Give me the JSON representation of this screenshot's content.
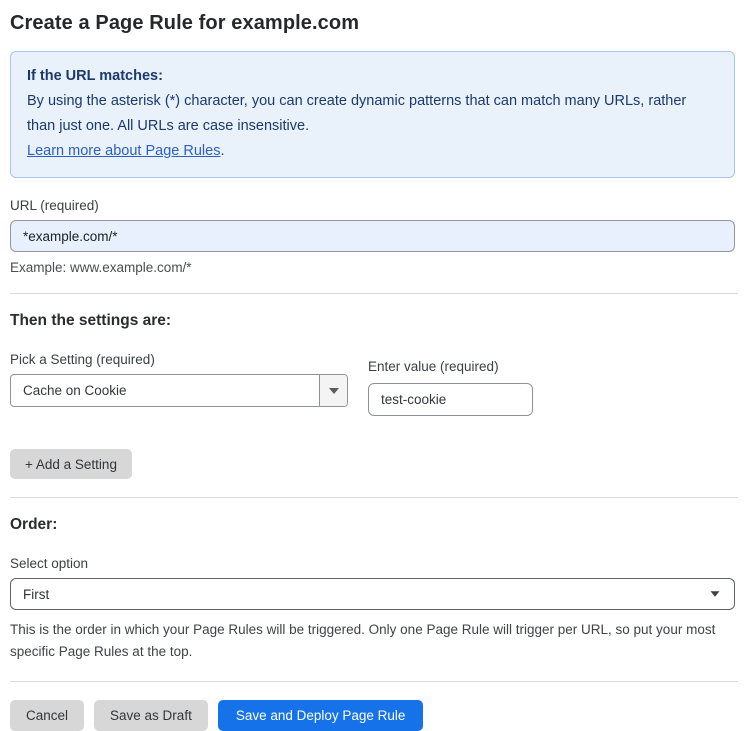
{
  "page": {
    "title": "Create a Page Rule for example.com"
  },
  "info_box": {
    "heading": "If the URL matches:",
    "body": "By using the asterisk (*) character, you can create dynamic patterns that can match many URLs, rather than just one. All URLs are case insensitive.",
    "link_label": "Learn more about Page Rules",
    "link_suffix": "."
  },
  "url_field": {
    "label": "URL (required)",
    "value": "*example.com/*",
    "example": "Example: www.example.com/*"
  },
  "settings": {
    "heading": "Then the settings are:",
    "setting_picker": {
      "label": "Pick a Setting (required)",
      "selected": "Cache on Cookie"
    },
    "value_field": {
      "label": "Enter value (required)",
      "value": "test-cookie"
    },
    "add_button_label": "+ Add a Setting"
  },
  "order": {
    "heading": "Order:",
    "select_label": "Select option",
    "selected": "First",
    "help": "This is the order in which your Page Rules will be triggered. Only one Page Rule will trigger per URL, so put your most specific Page Rules at the top."
  },
  "actions": {
    "cancel_label": "Cancel",
    "save_draft_label": "Save as Draft",
    "save_deploy_label": "Save and Deploy Page Rule"
  },
  "colors": {
    "accent_blue": "#1672e8",
    "info_bg": "#e9f1fb",
    "info_border": "#a9c7ec",
    "info_text": "#1b3a6b",
    "link_blue": "#2d5fc1",
    "autofill_input_bg": "#e8f0fe",
    "button_gray": "#d7d7d7"
  }
}
